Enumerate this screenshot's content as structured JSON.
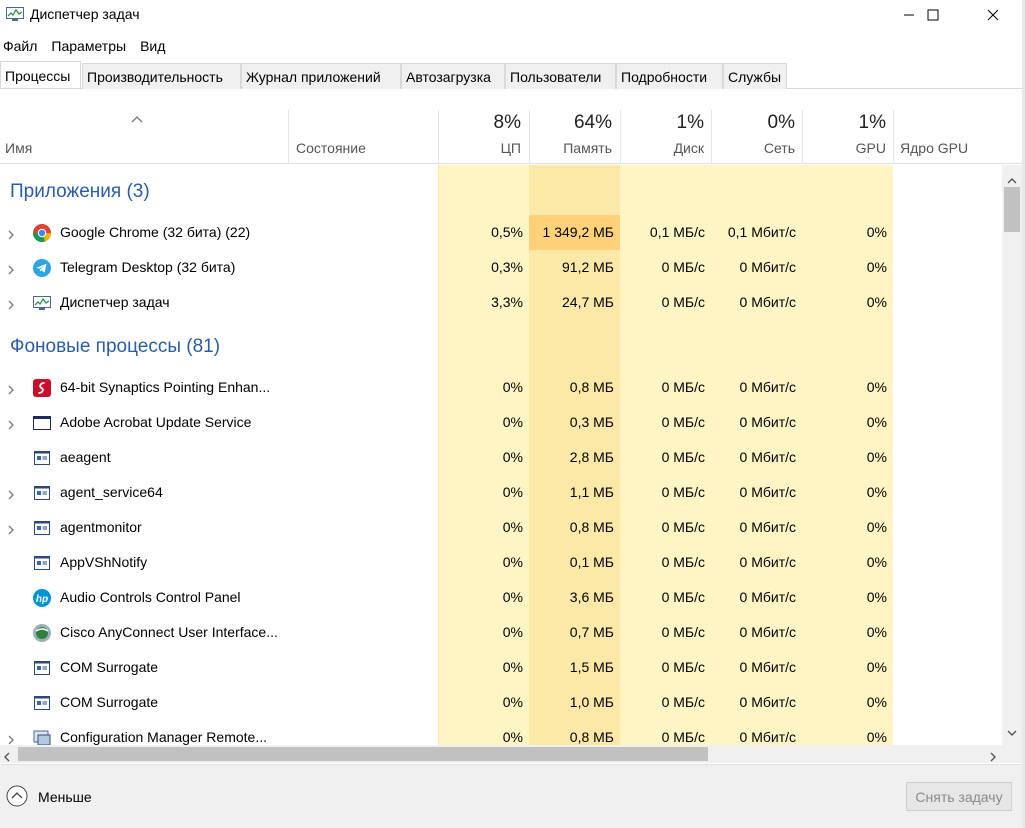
{
  "window": {
    "title": "Диспетчер задач"
  },
  "menu": [
    "Файл",
    "Параметры",
    "Вид"
  ],
  "tabs": [
    "Процессы",
    "Производительность",
    "Журнал приложений",
    "Автозагрузка",
    "Пользователи",
    "Подробности",
    "Службы"
  ],
  "active_tab": 0,
  "columns": {
    "name": "Имя",
    "status": "Состояние",
    "cpu": {
      "label": "ЦП",
      "pct": "8%"
    },
    "memory": {
      "label": "Память",
      "pct": "64%"
    },
    "disk": {
      "label": "Диск",
      "pct": "1%"
    },
    "network": {
      "label": "Сеть",
      "pct": "0%"
    },
    "gpu": {
      "label": "GPU",
      "pct": "1%"
    },
    "gpu_engine": {
      "label": "Ядро GPU"
    }
  },
  "groups": {
    "apps": {
      "title": "Приложения (3)"
    },
    "background": {
      "title": "Фоновые процессы (81)"
    }
  },
  "apps": [
    {
      "name": "Google Chrome (32 бита) (22)",
      "cpu": "0,5%",
      "mem": "1 349,2 МБ",
      "disk": "0,1 МБ/с",
      "net": "0,1 Мбит/с",
      "gpu": "0%",
      "expandable": true,
      "icon": "chrome-icon"
    },
    {
      "name": "Telegram Desktop (32 бита)",
      "cpu": "0,3%",
      "mem": "91,2 МБ",
      "disk": "0 МБ/с",
      "net": "0 Мбит/с",
      "gpu": "0%",
      "expandable": true,
      "icon": "telegram-icon"
    },
    {
      "name": "Диспетчер задач",
      "cpu": "3,3%",
      "mem": "24,7 МБ",
      "disk": "0 МБ/с",
      "net": "0 Мбит/с",
      "gpu": "0%",
      "expandable": true,
      "icon": "task-manager-icon"
    }
  ],
  "background": [
    {
      "name": "64-bit Synaptics Pointing Enhan...",
      "cpu": "0%",
      "mem": "0,8 МБ",
      "disk": "0 МБ/с",
      "net": "0 Мбит/с",
      "gpu": "0%",
      "expandable": true,
      "icon": "synaptics-icon"
    },
    {
      "name": "Adobe Acrobat Update Service",
      "cpu": "0%",
      "mem": "0,3 МБ",
      "disk": "0 МБ/с",
      "net": "0 Мбит/с",
      "gpu": "0%",
      "expandable": true,
      "icon": "window-icon"
    },
    {
      "name": "aeagent",
      "cpu": "0%",
      "mem": "2,8 МБ",
      "disk": "0 МБ/с",
      "net": "0 Мбит/с",
      "gpu": "0%",
      "expandable": false,
      "icon": "service-icon"
    },
    {
      "name": "agent_service64",
      "cpu": "0%",
      "mem": "1,1 МБ",
      "disk": "0 МБ/с",
      "net": "0 Мбит/с",
      "gpu": "0%",
      "expandable": true,
      "icon": "service-icon"
    },
    {
      "name": "agentmonitor",
      "cpu": "0%",
      "mem": "0,8 МБ",
      "disk": "0 МБ/с",
      "net": "0 Мбит/с",
      "gpu": "0%",
      "expandable": true,
      "icon": "service-icon"
    },
    {
      "name": "AppVShNotify",
      "cpu": "0%",
      "mem": "0,1 МБ",
      "disk": "0 МБ/с",
      "net": "0 Мбит/с",
      "gpu": "0%",
      "expandable": false,
      "icon": "service-icon"
    },
    {
      "name": "Audio Controls Control Panel",
      "cpu": "0%",
      "mem": "3,6 МБ",
      "disk": "0 МБ/с",
      "net": "0 Мбит/с",
      "gpu": "0%",
      "expandable": false,
      "icon": "hp-icon"
    },
    {
      "name": "Cisco AnyConnect User Interface...",
      "cpu": "0%",
      "mem": "0,7 МБ",
      "disk": "0 МБ/с",
      "net": "0 Мбит/с",
      "gpu": "0%",
      "expandable": false,
      "icon": "cisco-icon"
    },
    {
      "name": "COM Surrogate",
      "cpu": "0%",
      "mem": "1,5 МБ",
      "disk": "0 МБ/с",
      "net": "0 Мбит/с",
      "gpu": "0%",
      "expandable": false,
      "icon": "service-icon"
    },
    {
      "name": "COM Surrogate",
      "cpu": "0%",
      "mem": "1,0 МБ",
      "disk": "0 МБ/с",
      "net": "0 Мбит/с",
      "gpu": "0%",
      "expandable": false,
      "icon": "service-icon"
    },
    {
      "name": "Configuration Manager Remote...",
      "cpu": "0%",
      "mem": "0,8 МБ",
      "disk": "0 МБ/с",
      "net": "0 Мбит/с",
      "gpu": "0%",
      "expandable": true,
      "icon": "config-manager-icon"
    }
  ],
  "footer": {
    "fewer_label": "Меньше",
    "end_task_label": "Снять задачу"
  },
  "colors": {
    "accent": "#2a5caa",
    "heat_low": "#fff4c4",
    "heat_mid": "#fce9a8",
    "heat_high": "#ffd27a"
  }
}
